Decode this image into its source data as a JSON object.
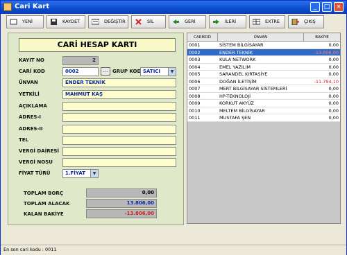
{
  "window": {
    "title": "Cari Kart"
  },
  "toolbar": {
    "new": "YENİ",
    "save": "KAYDET",
    "edit": "DEĞİŞTİR",
    "delete": "SİL",
    "back": "GERİ",
    "forward": "İLERİ",
    "statement": "EXTRE",
    "exit": "ÇIKIŞ"
  },
  "form": {
    "header": "CARİ HESAP KARTI",
    "kayit_no_label": "KAYIT NO",
    "kayit_no": "2",
    "cari_kod_label": "CARİ KOD",
    "cari_kod": "0002",
    "grup_kod_label": "GRUP KOD",
    "grup_kod": "SATICI",
    "unvan_label": "ÜNVAN",
    "unvan": "ENDER TEKNİK",
    "yetkili_label": "YETKİLİ",
    "yetkili": "MAHMUT KAŞ",
    "aciklama_label": "AÇIKLAMA",
    "aciklama": "",
    "adres1_label": "ADRES-I",
    "adres1": "",
    "adres2_label": "ADRES-II",
    "adres2": "",
    "tel_label": "TEL",
    "tel": "",
    "vergi_dairesi_label": "VERGİ DAİRESİ",
    "vergi_dairesi": "",
    "vergi_nosu_label": "VERGİ NOSU",
    "vergi_nosu": "",
    "fiyat_turu_label": "FİYAT TÜRÜ",
    "fiyat_turu": "1.FİYAT",
    "dots": "...",
    "arrow": "▼"
  },
  "totals": {
    "borc_label": "TOPLAM BORÇ",
    "borc": "0,00",
    "alacak_label": "TOPLAM ALACAK",
    "alacak": "13.806,00",
    "bakiye_label": "KALAN BAKİYE",
    "bakiye": "-13.806,00"
  },
  "grid": {
    "headers": [
      "CARİKOD",
      "ÜNVAN",
      "BAKİYE"
    ],
    "rows": [
      {
        "kod": "0001",
        "unvan": "SİSTEM BİLGİSAYAR",
        "bakiye": "0,00"
      },
      {
        "kod": "0002",
        "unvan": "ENDER TEKNİK",
        "bakiye": "-13.806,00"
      },
      {
        "kod": "0003",
        "unvan": "KULA NETWORK",
        "bakiye": "0,00"
      },
      {
        "kod": "0004",
        "unvan": "EMEL YAZILIM",
        "bakiye": "0,00"
      },
      {
        "kod": "0005",
        "unvan": "SARANDEL KIRTASİYE",
        "bakiye": "0,00"
      },
      {
        "kod": "0006",
        "unvan": "DOĞAN İLETİŞİM",
        "bakiye": "-11.794,10"
      },
      {
        "kod": "0007",
        "unvan": "MERT BİLGİSAYAR SİSTEMLERİ",
        "bakiye": "0,00"
      },
      {
        "kod": "0008",
        "unvan": "HP-TEKNOLOJİ",
        "bakiye": "0,00"
      },
      {
        "kod": "0009",
        "unvan": "KORKUT AKYÜZ",
        "bakiye": "0,00"
      },
      {
        "kod": "0010",
        "unvan": "MELTEM BİLGİSAYAR",
        "bakiye": "0,00"
      },
      {
        "kod": "0011",
        "unvan": "MUSTAFA ŞEN",
        "bakiye": "0,00"
      }
    ]
  },
  "status": {
    "text": "En son cari kodu : 0011"
  },
  "colors": {
    "selection": "#316ac5",
    "negative": "#d42020",
    "panel": "#dfe8c8"
  }
}
